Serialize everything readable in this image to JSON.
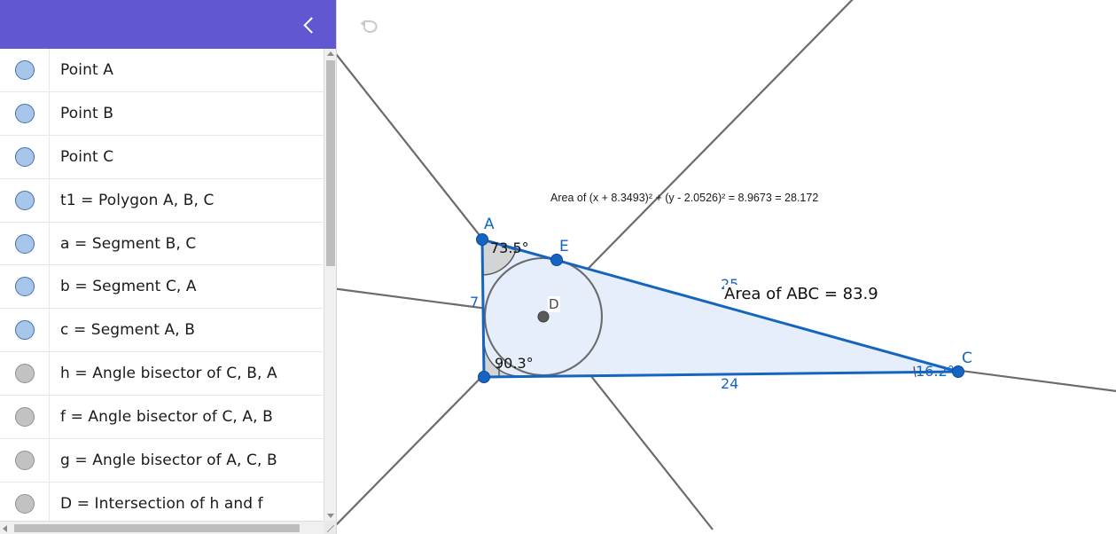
{
  "sidebar": {
    "header": {
      "collapse_icon": "chevron-left-icon"
    },
    "items": [
      {
        "label": "Point A",
        "visible": true
      },
      {
        "label": "Point B",
        "visible": true
      },
      {
        "label": "Point C",
        "visible": true
      },
      {
        "label": "t1 = Polygon A, B, C",
        "visible": true
      },
      {
        "label": "a = Segment B, C",
        "visible": true
      },
      {
        "label": "b = Segment C, A",
        "visible": true
      },
      {
        "label": "c = Segment A, B",
        "visible": true
      },
      {
        "label": "h = Angle bisector of C, B, A",
        "visible": false
      },
      {
        "label": "f = Angle bisector of C, A, B",
        "visible": false
      },
      {
        "label": "g = Angle bisector of A, C, B",
        "visible": false
      },
      {
        "label": "D = Intersection of h and f",
        "visible": false
      }
    ]
  },
  "toolbar": {
    "undo_icon": "undo-arrow-icon"
  },
  "canvas": {
    "equation_label": "Area of (x + 8.3493)² + (y - 2.0526)² = 8.9673 = 28.172",
    "area_label": "Area of  ABC = 83.9",
    "occluded_side_label": "25",
    "points": [
      {
        "name": "A",
        "label": "A"
      },
      {
        "name": "B",
        "label": ""
      },
      {
        "name": "C",
        "label": "C"
      },
      {
        "name": "D",
        "label": "D"
      },
      {
        "name": "E",
        "label": "E"
      }
    ],
    "angles": [
      {
        "at": "A",
        "value": "73.5°"
      },
      {
        "at": "B",
        "value": "90.3°"
      },
      {
        "at": "C",
        "value": "16.2°"
      }
    ],
    "sides": [
      {
        "name": "c",
        "value": "7"
      },
      {
        "name": "a",
        "value": "24"
      }
    ],
    "colors": {
      "accent_purple": "#6157D0",
      "object_blue": "#1565c0",
      "polygon_fill": "#e5eefa",
      "line_gray": "#6b6b6b"
    }
  }
}
